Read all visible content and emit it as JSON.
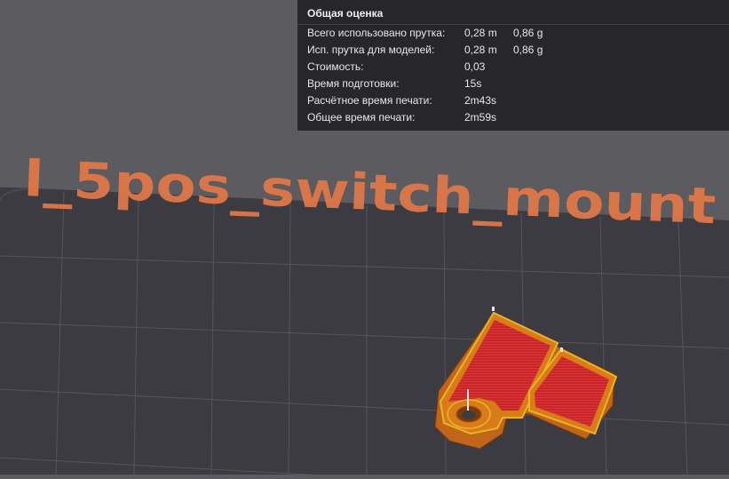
{
  "estimate_panel": {
    "title": "Общая оценка",
    "rows": [
      {
        "label": "Всего использовано прутка:",
        "value1": "0,28 m",
        "value2": "0,86 g"
      },
      {
        "label": "Исп. прутка для моделей:",
        "value1": "0,28 m",
        "value2": "0,86 g"
      },
      {
        "label": "Стоимость:",
        "value1": "0,03",
        "value2": ""
      },
      {
        "label": "Время подготовки:",
        "value1": "15s",
        "value2": ""
      },
      {
        "label": "Расчётное время печати:",
        "value1": "2m43s",
        "value2": ""
      },
      {
        "label": "Общее время печати:",
        "value1": "2m59s",
        "value2": ""
      }
    ]
  },
  "viewport": {
    "plate_label": "l_5pos_switch_mount",
    "colors": {
      "background": "#5b5b60",
      "plate": "#3c3b42",
      "grid": "#55545c",
      "plate_label": "#e07848",
      "infill": "#c8262a",
      "wall": "#d97b18",
      "outer_wall": "#e8b624"
    }
  }
}
